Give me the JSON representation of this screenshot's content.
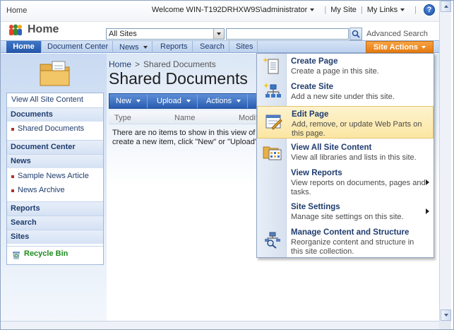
{
  "global": {
    "home_link": "Home",
    "welcome": "Welcome WIN-T192DRHXW9S\\administrator",
    "my_site": "My Site",
    "my_links": "My Links",
    "help_symbol": "?"
  },
  "title_area": {
    "site_name": "Home",
    "scope_value": "All Sites",
    "search_value": "",
    "advanced_search": "Advanced Search"
  },
  "tabs": [
    {
      "label": "Home",
      "selected": true
    },
    {
      "label": "Document Center"
    },
    {
      "label": "News",
      "dropdown": true
    },
    {
      "label": "Reports"
    },
    {
      "label": "Search"
    },
    {
      "label": "Sites"
    }
  ],
  "site_actions": "Site Actions",
  "quick_launch": {
    "view_all": "View All Site Content",
    "documents": "Documents",
    "shared_documents": "Shared Documents",
    "document_center": "Document Center",
    "news": "News",
    "sample_news": "Sample News Article",
    "news_archive": "News Archive",
    "reports": "Reports",
    "search": "Search",
    "sites": "Sites",
    "recycle_bin": "Recycle Bin"
  },
  "breadcrumb": {
    "home": "Home",
    "sep": ">",
    "current": "Shared Documents"
  },
  "page_title": "Shared Documents",
  "toolbar": {
    "new": "New",
    "upload": "Upload",
    "actions": "Actions"
  },
  "list": {
    "col_type": "Type",
    "col_name": "Name",
    "col_modified": "Modifi",
    "empty_line1": "There are no items to show in this view of t",
    "empty_line2": "create a new item, click \"New\" or \"Upload\""
  },
  "menu": [
    {
      "title": "Create Page",
      "desc": "Create a page in this site.",
      "icon": "create-page-icon"
    },
    {
      "title": "Create Site",
      "desc": "Add a new site under this site.",
      "icon": "create-site-icon"
    },
    {
      "title": "Edit Page",
      "desc": "Add, remove, or update Web Parts on this page.",
      "icon": "edit-page-icon",
      "highlight": true
    },
    {
      "title": "View All Site Content",
      "desc": "View all libraries and lists in this site.",
      "icon": "view-all-content-icon"
    },
    {
      "title": "View Reports",
      "desc": "View reports on documents, pages and tasks.",
      "icon": "view-reports-icon",
      "submenu": true
    },
    {
      "title": "Site Settings",
      "desc": "Manage site settings on this site.",
      "icon": "site-settings-icon",
      "submenu": true
    },
    {
      "title": "Manage Content and Structure",
      "desc": "Reorganize content and structure in this site collection.",
      "icon": "manage-content-icon"
    }
  ]
}
